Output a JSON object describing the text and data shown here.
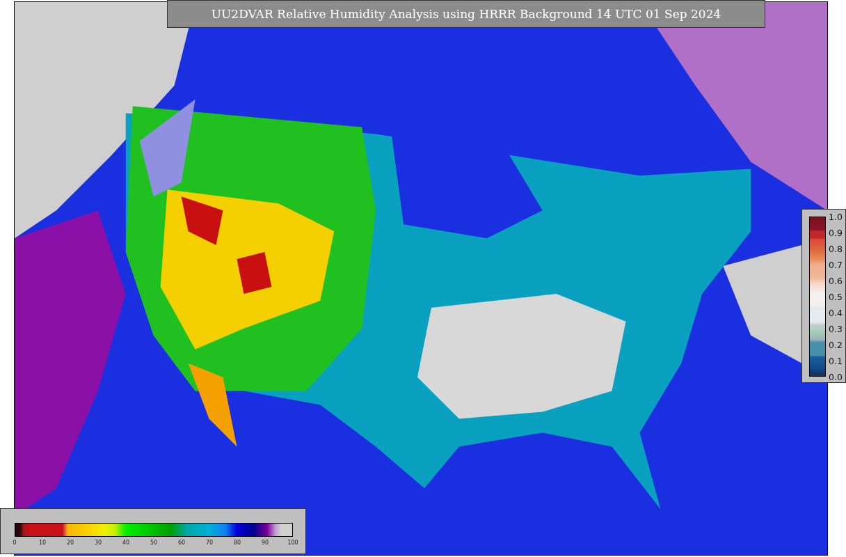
{
  "title": "UU2DVAR Relative Humidity Analysis using HRRR Background 14 UTC 01 Sep 2024",
  "humidity_colorbar": {
    "ticks": [
      "0",
      "10",
      "20",
      "30",
      "40",
      "50",
      "60",
      "70",
      "80",
      "90",
      "100"
    ]
  },
  "ratio_colorbar": {
    "ticks": [
      "1.0",
      "0.9",
      "0.8",
      "0.7",
      "0.6",
      "0.5",
      "0.4",
      "0.3",
      "0.2",
      "0.1",
      "0.0"
    ]
  }
}
